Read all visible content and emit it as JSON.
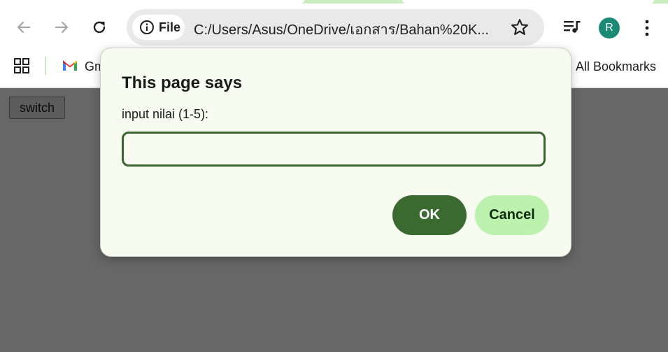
{
  "browser": {
    "nav": {
      "back_icon": "arrow-left-icon",
      "forward_icon": "arrow-right-icon",
      "reload_icon": "reload-icon"
    },
    "omnibox": {
      "chip_label": "File",
      "chip_icon": "info-icon",
      "url": "C:/Users/Asus/OneDrive/เอกสาร/Bahan%20K...",
      "star_icon": "star-icon"
    },
    "toolbar_right": {
      "media_icon": "media-queue-icon",
      "avatar_letter": "R",
      "avatar_color": "#1a8a75",
      "menu_icon": "kebab-menu-icon"
    }
  },
  "bookmarks": {
    "apps_icon": "apps-grid-icon",
    "gmail_label": "Gm",
    "all_bookmarks": "All Bookmarks"
  },
  "page": {
    "switch_label": "switch"
  },
  "dialog": {
    "title": "This page says",
    "message": "input nilai (1-5):",
    "input_value": "",
    "ok_label": "OK",
    "cancel_label": "Cancel",
    "accent": "#3b6a31",
    "cancel_color": "#bcf2ae"
  }
}
